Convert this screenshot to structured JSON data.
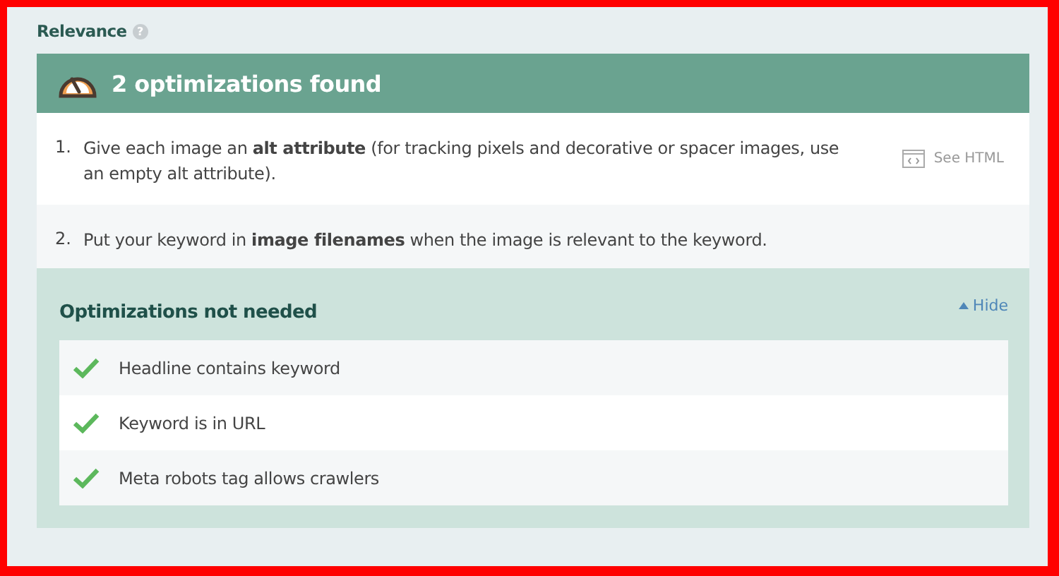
{
  "section": {
    "title": "Relevance",
    "help_icon": "?"
  },
  "found": {
    "title": "2 optimizations found",
    "items": [
      {
        "number": "1.",
        "text": "Give each image an **alt attribute** (for tracking pixels and decorative or spacer images, use an empty alt attribute).",
        "action": "See HTML"
      },
      {
        "number": "2.",
        "text": "Put your keyword in **image filenames** when the image is relevant to the keyword."
      }
    ]
  },
  "not_needed": {
    "title": "Optimizations not needed",
    "toggle": "Hide",
    "expanded": true,
    "items": [
      {
        "text": "Headline contains keyword",
        "passed": true
      },
      {
        "text": "Keyword is in URL",
        "passed": true
      },
      {
        "text": "Meta robots tag allows crawlers",
        "passed": true
      }
    ]
  }
}
